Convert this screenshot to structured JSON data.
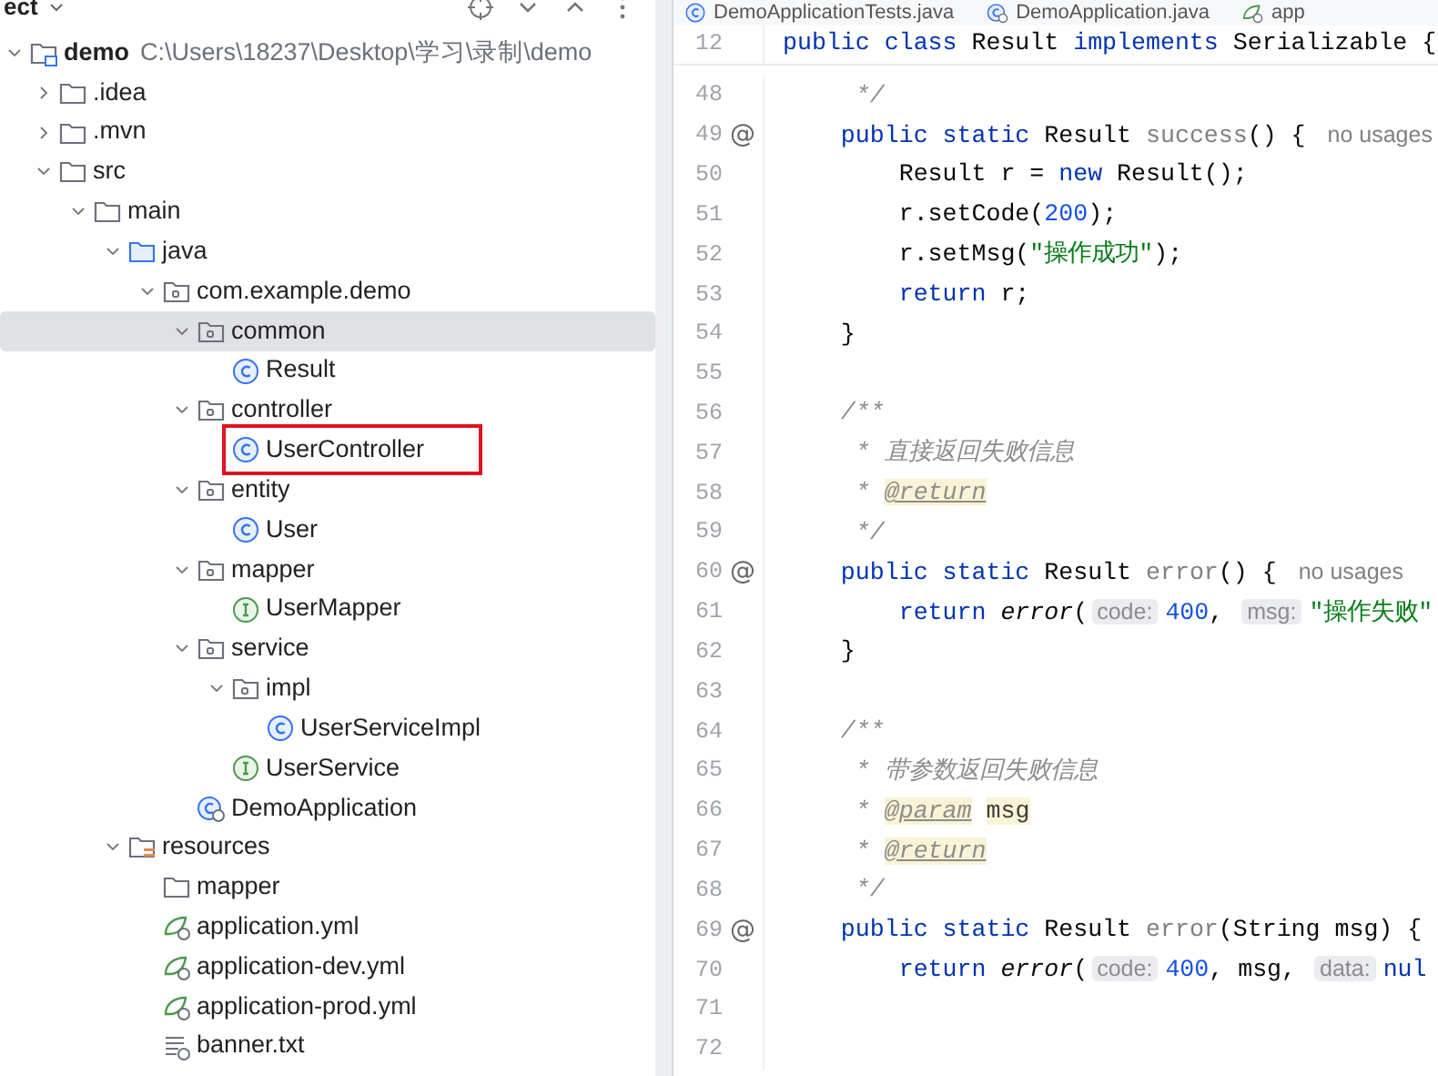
{
  "project_panel": {
    "title": "ect",
    "tree": [
      {
        "name": "demo",
        "path": "C:\\Users\\18237\\Desktop\\学习\\录制\\demo",
        "kind": "module",
        "expanded": true,
        "selected": false,
        "children": [
          {
            "name": ".idea",
            "kind": "folder",
            "expanded": false,
            "selected": false
          },
          {
            "name": ".mvn",
            "kind": "folder",
            "expanded": false,
            "selected": false
          },
          {
            "name": "src",
            "kind": "folder",
            "expanded": true,
            "selected": false,
            "children": [
              {
                "name": "main",
                "kind": "folder",
                "expanded": true,
                "selected": false,
                "children": [
                  {
                    "name": "java",
                    "kind": "source-folder",
                    "expanded": true,
                    "selected": false,
                    "children": [
                      {
                        "name": "com.example.demo",
                        "kind": "package",
                        "expanded": true,
                        "selected": false,
                        "children": [
                          {
                            "name": "common",
                            "kind": "package",
                            "expanded": true,
                            "selected": true,
                            "children": [
                              {
                                "name": "Result",
                                "kind": "class",
                                "selected": false
                              }
                            ]
                          },
                          {
                            "name": "controller",
                            "kind": "package",
                            "expanded": true,
                            "selected": false,
                            "children": [
                              {
                                "name": "UserController",
                                "kind": "class",
                                "selected": false,
                                "highlighted": true
                              }
                            ]
                          },
                          {
                            "name": "entity",
                            "kind": "package",
                            "expanded": true,
                            "selected": false,
                            "children": [
                              {
                                "name": "User",
                                "kind": "class",
                                "selected": false
                              }
                            ]
                          },
                          {
                            "name": "mapper",
                            "kind": "package",
                            "expanded": true,
                            "selected": false,
                            "children": [
                              {
                                "name": "UserMapper",
                                "kind": "interface",
                                "selected": false
                              }
                            ]
                          },
                          {
                            "name": "service",
                            "kind": "package",
                            "expanded": true,
                            "selected": false,
                            "children": [
                              {
                                "name": "impl",
                                "kind": "package",
                                "expanded": true,
                                "selected": false,
                                "children": [
                                  {
                                    "name": "UserServiceImpl",
                                    "kind": "class",
                                    "selected": false
                                  }
                                ]
                              },
                              {
                                "name": "UserService",
                                "kind": "interface",
                                "selected": false
                              }
                            ]
                          },
                          {
                            "name": "DemoApplication",
                            "kind": "app-class",
                            "selected": false
                          }
                        ]
                      }
                    ]
                  },
                  {
                    "name": "resources",
                    "kind": "resources-folder",
                    "expanded": true,
                    "selected": false,
                    "children": [
                      {
                        "name": "mapper",
                        "kind": "folder",
                        "selected": false
                      },
                      {
                        "name": "application.yml",
                        "kind": "spring-config",
                        "selected": false
                      },
                      {
                        "name": "application-dev.yml",
                        "kind": "spring-config",
                        "selected": false
                      },
                      {
                        "name": "application-prod.yml",
                        "kind": "spring-config",
                        "selected": false
                      },
                      {
                        "name": "banner.txt",
                        "kind": "text-file",
                        "selected": false
                      }
                    ]
                  }
                ]
              }
            ]
          }
        ]
      }
    ]
  },
  "editor": {
    "tabs": [
      {
        "label": "DemoApplicationTests.java",
        "kind": "class"
      },
      {
        "label": "DemoApplication.java",
        "kind": "app-class"
      },
      {
        "label": "app",
        "kind": "spring-config"
      }
    ],
    "sticky_line": {
      "number": "12",
      "tokens": [
        {
          "kind": "kw",
          "text": "public class "
        },
        {
          "kind": "plain",
          "text": "Result "
        },
        {
          "kind": "kw",
          "text": "implements "
        },
        {
          "kind": "plain",
          "text": "Serializable {"
        }
      ]
    },
    "lines": [
      {
        "number": "48",
        "tokens": [
          {
            "kind": "comment",
            "text": "     */"
          }
        ]
      },
      {
        "number": "49",
        "gutter": "@",
        "tokens": [
          {
            "kind": "kw",
            "text": "    public static "
          },
          {
            "kind": "plain",
            "text": "Result "
          },
          {
            "kind": "unused",
            "text": "success"
          },
          {
            "kind": "plain",
            "text": "() {"
          },
          {
            "kind": "lens",
            "text": "no usages"
          }
        ]
      },
      {
        "number": "50",
        "tokens": [
          {
            "kind": "plain",
            "text": "        Result r = "
          },
          {
            "kind": "kw",
            "text": "new "
          },
          {
            "kind": "plain",
            "text": "Result();"
          }
        ]
      },
      {
        "number": "51",
        "tokens": [
          {
            "kind": "plain",
            "text": "        r.setCode("
          },
          {
            "kind": "num",
            "text": "200"
          },
          {
            "kind": "plain",
            "text": ");"
          }
        ]
      },
      {
        "number": "52",
        "tokens": [
          {
            "kind": "plain",
            "text": "        r.setMsg("
          },
          {
            "kind": "str",
            "text": "\"操作成功\""
          },
          {
            "kind": "plain",
            "text": ");"
          }
        ]
      },
      {
        "number": "53",
        "tokens": [
          {
            "kind": "kw",
            "text": "        return "
          },
          {
            "kind": "plain",
            "text": "r;"
          }
        ]
      },
      {
        "number": "54",
        "tokens": [
          {
            "kind": "plain",
            "text": "    }"
          }
        ]
      },
      {
        "number": "55"
      },
      {
        "number": "56",
        "tokens": [
          {
            "kind": "comment",
            "text": "    /**"
          }
        ]
      },
      {
        "number": "57",
        "tokens": [
          {
            "kind": "comment",
            "text": "     * 直接返回失败信息"
          }
        ]
      },
      {
        "number": "58",
        "tokens": [
          {
            "kind": "comment",
            "text": "     * "
          },
          {
            "kind": "tag",
            "text": "@return"
          }
        ]
      },
      {
        "number": "59",
        "tokens": [
          {
            "kind": "comment",
            "text": "     */"
          }
        ]
      },
      {
        "number": "60",
        "gutter": "@",
        "tokens": [
          {
            "kind": "kw",
            "text": "    public static "
          },
          {
            "kind": "plain",
            "text": "Result "
          },
          {
            "kind": "unused",
            "text": "error"
          },
          {
            "kind": "plain",
            "text": "() {"
          },
          {
            "kind": "lens",
            "text": "no usages"
          }
        ]
      },
      {
        "number": "61",
        "tokens": [
          {
            "kind": "kw",
            "text": "        return "
          },
          {
            "kind": "call",
            "text": "error"
          },
          {
            "kind": "plain",
            "text": "("
          },
          {
            "kind": "hint",
            "text": "code:"
          },
          {
            "kind": "num",
            "text": "400"
          },
          {
            "kind": "plain",
            "text": ", "
          },
          {
            "kind": "hint",
            "text": "msg:"
          },
          {
            "kind": "str",
            "text": "\"操作失败\""
          }
        ]
      },
      {
        "number": "62",
        "tokens": [
          {
            "kind": "plain",
            "text": "    }"
          }
        ]
      },
      {
        "number": "63"
      },
      {
        "number": "64",
        "tokens": [
          {
            "kind": "comment",
            "text": "    /**"
          }
        ]
      },
      {
        "number": "65",
        "tokens": [
          {
            "kind": "comment",
            "text": "     * 带参数返回失败信息"
          }
        ]
      },
      {
        "number": "66",
        "tokens": [
          {
            "kind": "comment",
            "text": "     * "
          },
          {
            "kind": "tag",
            "text": "@param"
          },
          {
            "kind": "tagref",
            "text": "msg"
          }
        ]
      },
      {
        "number": "67",
        "tokens": [
          {
            "kind": "comment",
            "text": "     * "
          },
          {
            "kind": "tag",
            "text": "@return"
          }
        ]
      },
      {
        "number": "68",
        "tokens": [
          {
            "kind": "comment",
            "text": "     */"
          }
        ]
      },
      {
        "number": "69",
        "gutter": "@",
        "tokens": [
          {
            "kind": "kw",
            "text": "    public static "
          },
          {
            "kind": "plain",
            "text": "Result "
          },
          {
            "kind": "unused",
            "text": "error"
          },
          {
            "kind": "plain",
            "text": "(String msg) {"
          }
        ]
      },
      {
        "number": "70",
        "tokens": [
          {
            "kind": "kw",
            "text": "        return "
          },
          {
            "kind": "call",
            "text": "error"
          },
          {
            "kind": "plain",
            "text": "("
          },
          {
            "kind": "hint",
            "text": "code:"
          },
          {
            "kind": "num",
            "text": "400"
          },
          {
            "kind": "plain",
            "text": ", msg, "
          },
          {
            "kind": "hint",
            "text": "data:"
          },
          {
            "kind": "kw",
            "text": "nul"
          }
        ]
      },
      {
        "number": "71"
      },
      {
        "number": "72"
      }
    ]
  }
}
